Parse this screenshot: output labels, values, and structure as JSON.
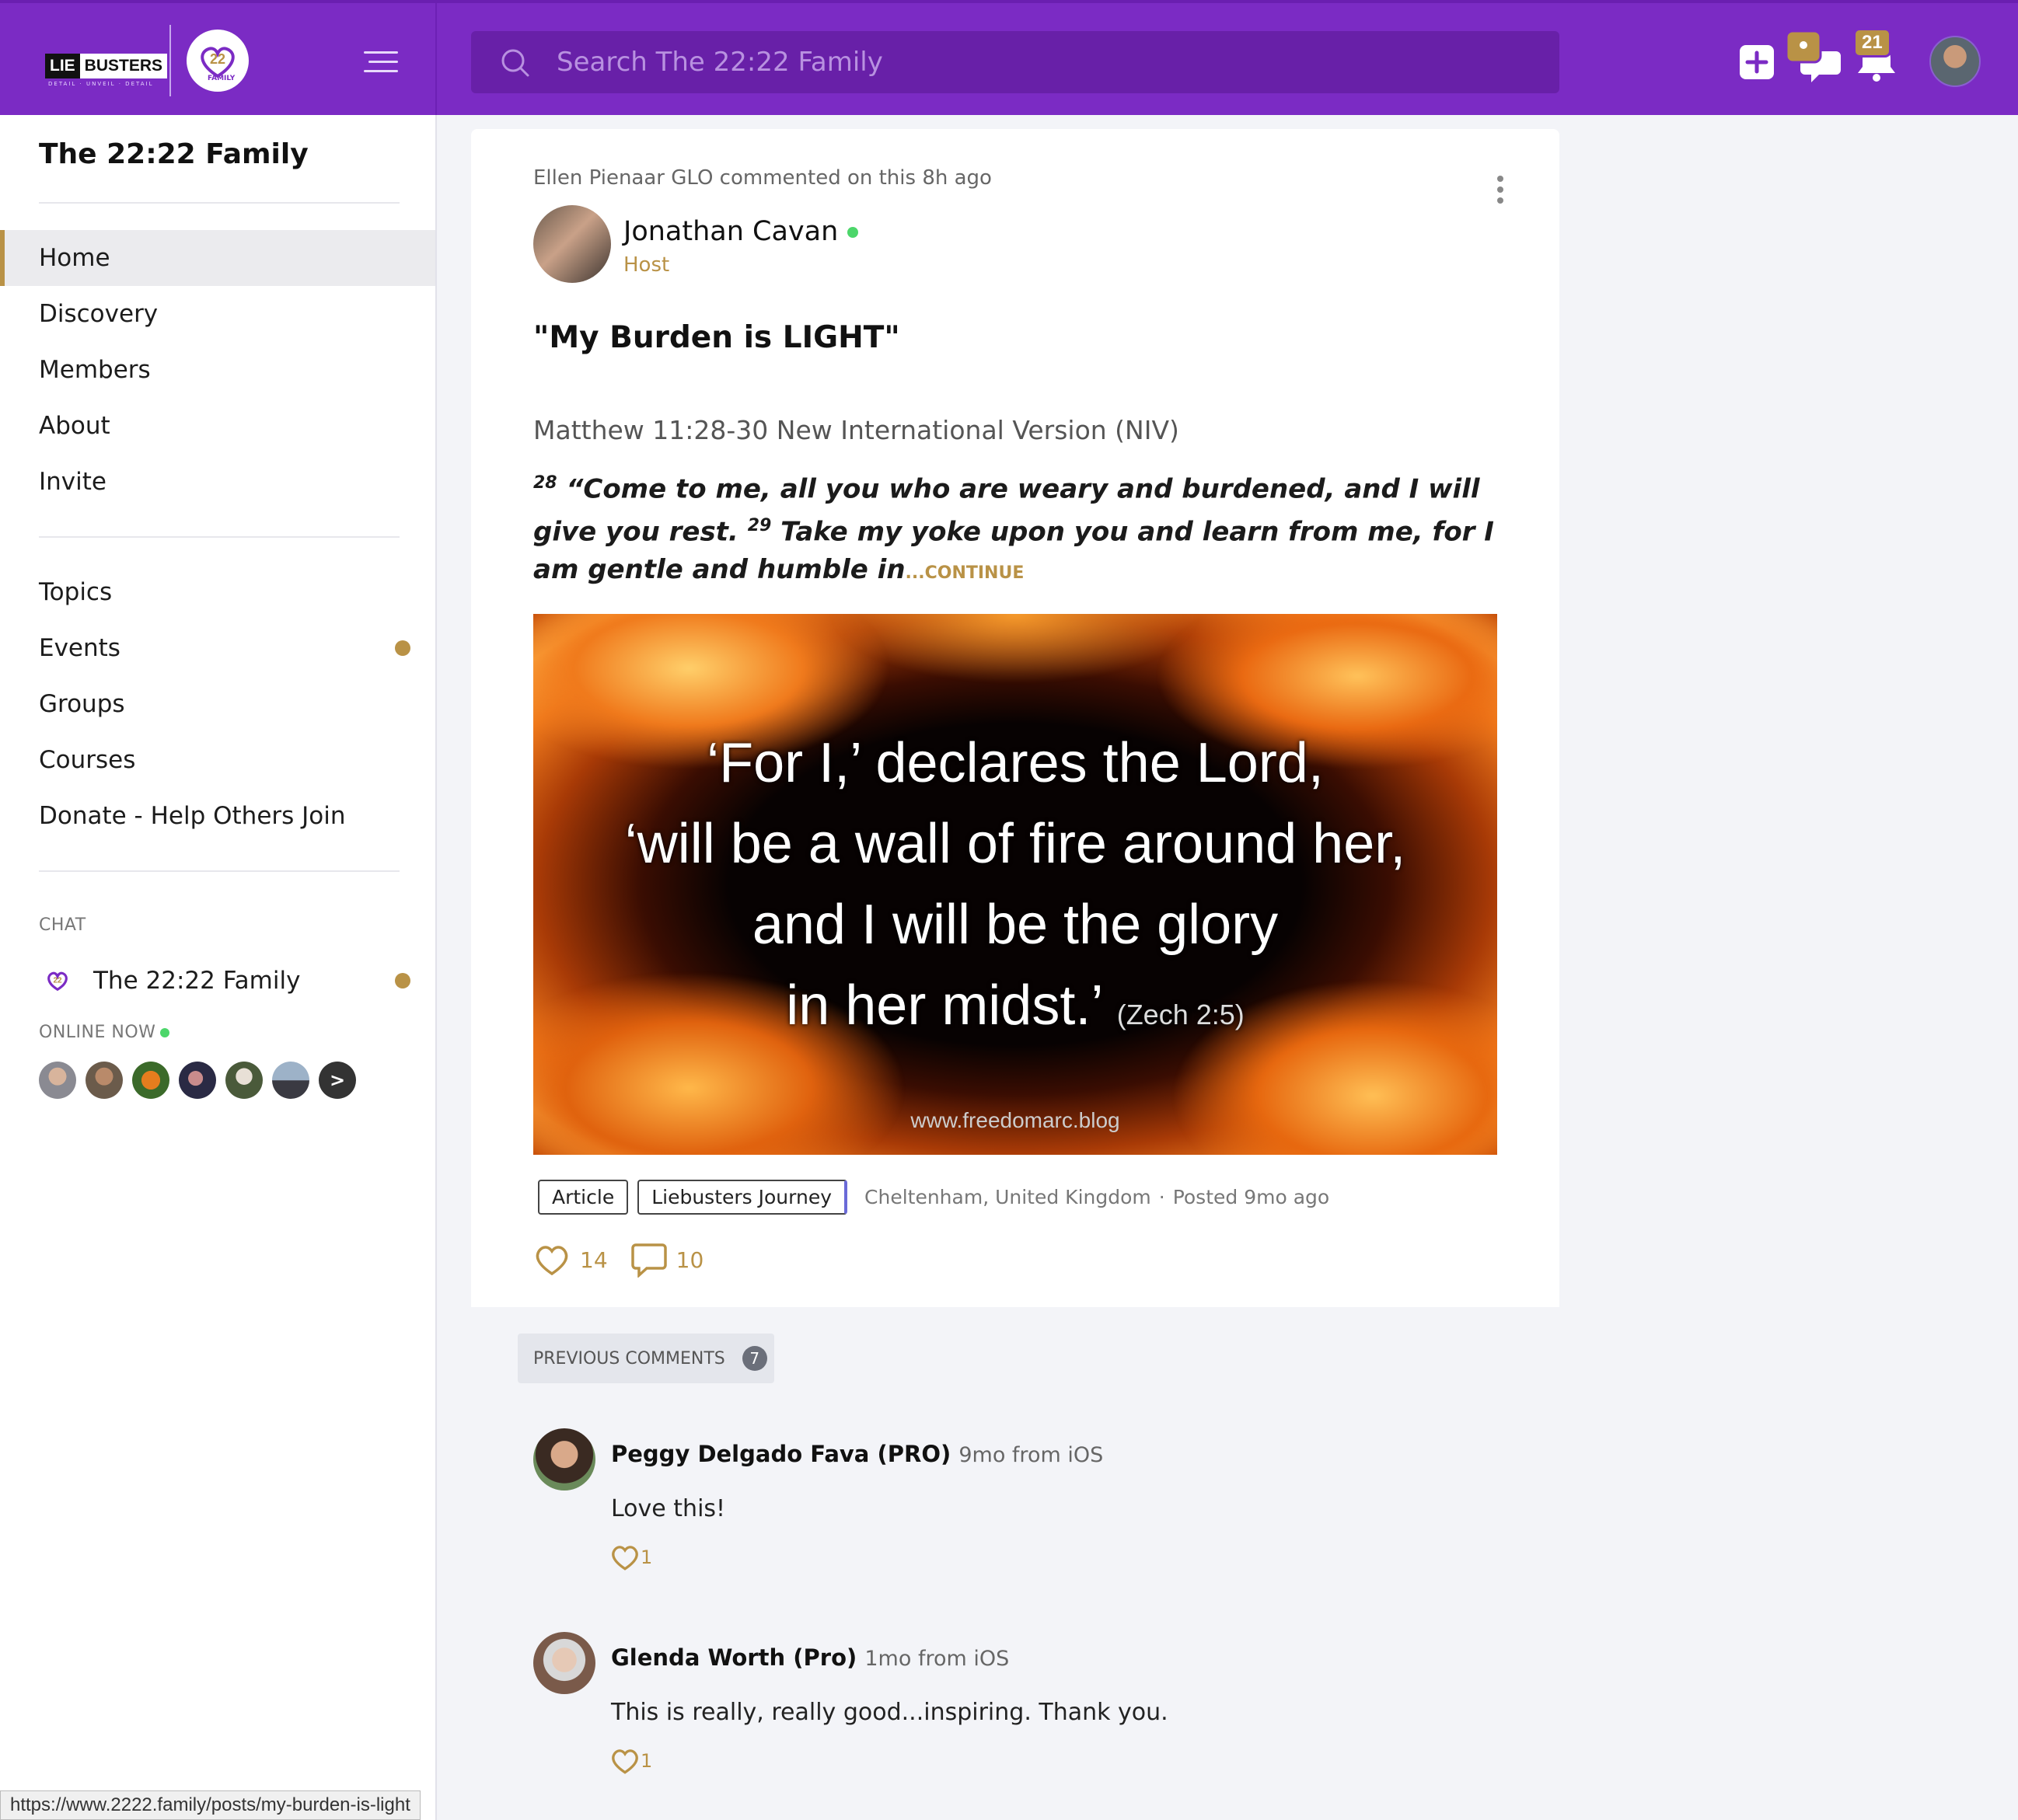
{
  "header": {
    "logo_lie": "LIE",
    "logo_busters": "BUSTERS",
    "logo_sub": "DETAIL · UNVEIL · DETAIL",
    "logo_family": "FAMILY",
    "search_placeholder": "Search The 22:22 Family",
    "chat_badge": "",
    "notification_badge": "21",
    "brand_color": "#7b2bc4",
    "accent_color": "#b99246"
  },
  "sidebar": {
    "title": "The 22:22 Family",
    "nav": [
      {
        "label": "Home",
        "active": true
      },
      {
        "label": "Discovery"
      },
      {
        "label": "Members"
      },
      {
        "label": "About"
      },
      {
        "label": "Invite"
      }
    ],
    "nav2": [
      {
        "label": "Topics"
      },
      {
        "label": "Events",
        "dot": true
      },
      {
        "label": "Groups"
      },
      {
        "label": "Courses"
      },
      {
        "label": "Donate - Help Others Join"
      }
    ],
    "chat_label": "CHAT",
    "chat_item": "The 22:22 Family",
    "online_label": "ONLINE NOW",
    "online_more": ">"
  },
  "post": {
    "activity": "Ellen Pienaar GLO commented on this 8h ago",
    "author": "Jonathan Cavan",
    "author_role": "Host",
    "title": "\"My Burden is LIGHT\"",
    "reference": "Matthew 11:28-30 New International Version (NIV)",
    "verse_28_num": "28",
    "verse_28": "“Come to me, all you who are weary and burdened, and I will give you rest.",
    "verse_29_num": "29",
    "verse_29": "Take my yoke upon you and learn from me, for I am gentle and humble in",
    "continue": "...CONTINUE",
    "image_line1": "‘For I,’ declares the Lord,",
    "image_line2": "‘will be a wall of fire around her,",
    "image_line3": "and I will be the glory",
    "image_line4": "in her midst.’",
    "image_ref": "(Zech 2:5)",
    "image_url": "www.freedomarc.blog",
    "tag1": "Article",
    "tag2": "Liebusters Journey",
    "location": "Cheltenham, United Kingdom",
    "separator": "·",
    "posted": "Posted 9mo ago",
    "likes": "14",
    "comments": "10"
  },
  "comments": {
    "previous_label": "PREVIOUS COMMENTS",
    "previous_count": "7",
    "items": [
      {
        "name": "Peggy Delgado Fava (PRO)",
        "time": "9mo from iOS",
        "text": "Love this!",
        "likes": "1"
      },
      {
        "name": "Glenda Worth (Pro)",
        "time": "1mo from iOS",
        "text": "This is really, really good...inspiring. Thank you.",
        "likes": "1"
      }
    ]
  },
  "status_bar_url": "https://www.2222.family/posts/my-burden-is-light"
}
